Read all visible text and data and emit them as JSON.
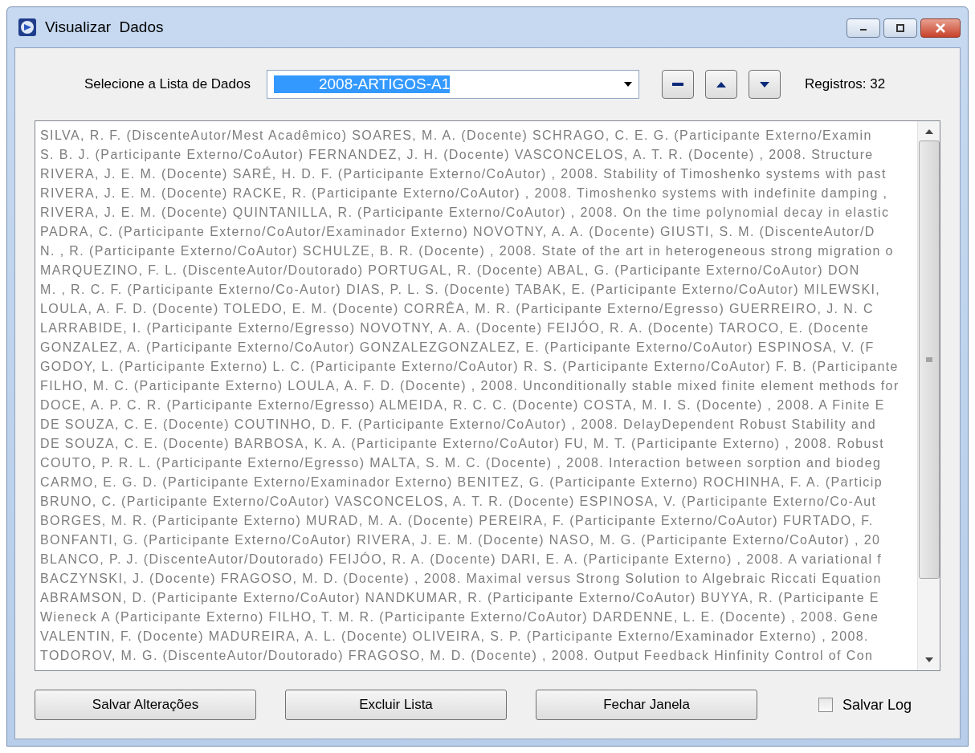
{
  "window": {
    "title": "Visualizar  Dados"
  },
  "selector": {
    "label": "Selecione a Lista de Dados",
    "value": "2008-ARTIGOS-A1",
    "text_selected": true
  },
  "list_buttons": [
    {
      "kind": "remove"
    },
    {
      "kind": "up"
    },
    {
      "kind": "down"
    }
  ],
  "record_count": "Registros: 32",
  "records": [
    "SILVA, R. F. (DiscenteAutor/Mest Acadêmico) SOARES, M. A. (Docente) SCHRAGO, C. E. G. (Participante Externo/Examin",
    "S. B. J. (Participante Externo/CoAutor) FERNANDEZ, J. H. (Docente) VASCONCELOS, A. T. R. (Docente) , 2008. Structure",
    "RIVERA, J. E. M. (Docente) SARÉ, H. D. F. (Participante Externo/CoAutor) , 2008. Stability of Timoshenko systems with past",
    "RIVERA, J. E. M. (Docente) RACKE, R. (Participante Externo/CoAutor) , 2008. Timoshenko systems with indefinite damping ,",
    "RIVERA, J. E. M. (Docente) QUINTANILLA, R. (Participante Externo/CoAutor) , 2008. On the time polynomial decay in elastic",
    "PADRA, C. (Participante Externo/CoAutor/Examinador Externo) NOVOTNY, A. A. (Docente) GIUSTI, S. M. (DiscenteAutor/D",
    "N. , R. (Participante Externo/CoAutor) SCHULZE, B. R. (Docente) , 2008. State of the art in heterogeneous strong migration o",
    "MARQUEZINO, F. L. (DiscenteAutor/Doutorado) PORTUGAL, R. (Docente) ABAL, G. (Participante Externo/CoAutor) DON",
    "M. , R. C. F. (Participante Externo/Co-Autor) DIAS, P. L. S. (Docente) TABAK, E. (Participante Externo/CoAutor) MILEWSKI,",
    "LOULA, A. F. D. (Docente) TOLEDO, E. M. (Docente) CORRÊA, M. R. (Participante Externo/Egresso) GUERREIRO, J. N. C",
    "LARRABIDE, I. (Participante Externo/Egresso) NOVOTNY, A. A. (Docente) FEIJÓO, R. A. (Docente) TAROCO, E. (Docente",
    "GONZALEZ, A. (Participante Externo/CoAutor) GONZALEZGONZALEZ, E. (Participante Externo/CoAutor) ESPINOSA, V. (F",
    "GODOY, L. (Participante Externo) L. C. (Participante Externo/CoAutor) R. S. (Participante Externo/CoAutor) F. B. (Participante",
    "FILHO, M. C. (Participante Externo) LOULA, A. F. D. (Docente) , 2008. Unconditionally stable mixed finite element methods for",
    "DOCE, A. P. C. R. (Participante Externo/Egresso) ALMEIDA, R. C. C. (Docente) COSTA, M. I. S. (Docente) , 2008. A Finite E",
    "DE SOUZA, C. E. (Docente) COUTINHO, D. F. (Participante Externo/CoAutor) , 2008. DelayDependent Robust Stability and",
    "DE SOUZA, C. E. (Docente) BARBOSA, K. A. (Participante Externo/CoAutor) FU, M. T. (Participante Externo) , 2008. Robust",
    "COUTO, P. R. L. (Participante Externo/Egresso) MALTA, S. M. C. (Docente) , 2008. Interaction between sorption and biodeg",
    "CARMO, E. G. D. (Participante Externo/Examinador Externo) BENITEZ, G. (Participante Externo) ROCHINHA, F. A. (Particip",
    "BRUNO, C. (Participante Externo/CoAutor) VASCONCELOS, A. T. R. (Docente) ESPINOSA, V. (Participante Externo/Co-Aut",
    "BORGES, M. R. (Participante Externo) MURAD, M. A. (Docente) PEREIRA, F. (Participante Externo/CoAutor) FURTADO, F.",
    "BONFANTI, G. (Participante Externo/CoAutor) RIVERA, J. E. M. (Docente) NASO, M. G. (Participante Externo/CoAutor) , 20",
    "BLANCO, P. J. (DiscenteAutor/Doutorado) FEIJÓO, R. A. (Docente) DARI, E. A. (Participante Externo) , 2008. A variational f",
    "BACZYNSKI, J. (Docente) FRAGOSO, M. D. (Docente) , 2008. Maximal versus Strong Solution to Algebraic Riccati Equation",
    "ABRAMSON, D. (Participante Externo/CoAutor) NANDKUMAR, R. (Participante Externo/CoAutor) BUYYA, R. (Participante E",
    "Wieneck A (Participante Externo) FILHO, T. M. R. (Participante Externo/CoAutor) DARDENNE, L. E. (Docente) , 2008. Gene",
    "VALENTIN, F. (Docente) MADUREIRA, A. L. (Docente) OLIVEIRA, S. P. (Participante Externo/Examinador Externo) , 2008.",
    "TODOROV, M. G. (DiscenteAutor/Doutorado) FRAGOSO, M. D. (Docente) , 2008. Output Feedback Hinfinity Control of Con"
  ],
  "buttons": [
    "Salvar Alterações",
    "Excluir Lista",
    "Fechar Janela"
  ],
  "save_log": {
    "label": "Salvar Log",
    "checked": false
  }
}
